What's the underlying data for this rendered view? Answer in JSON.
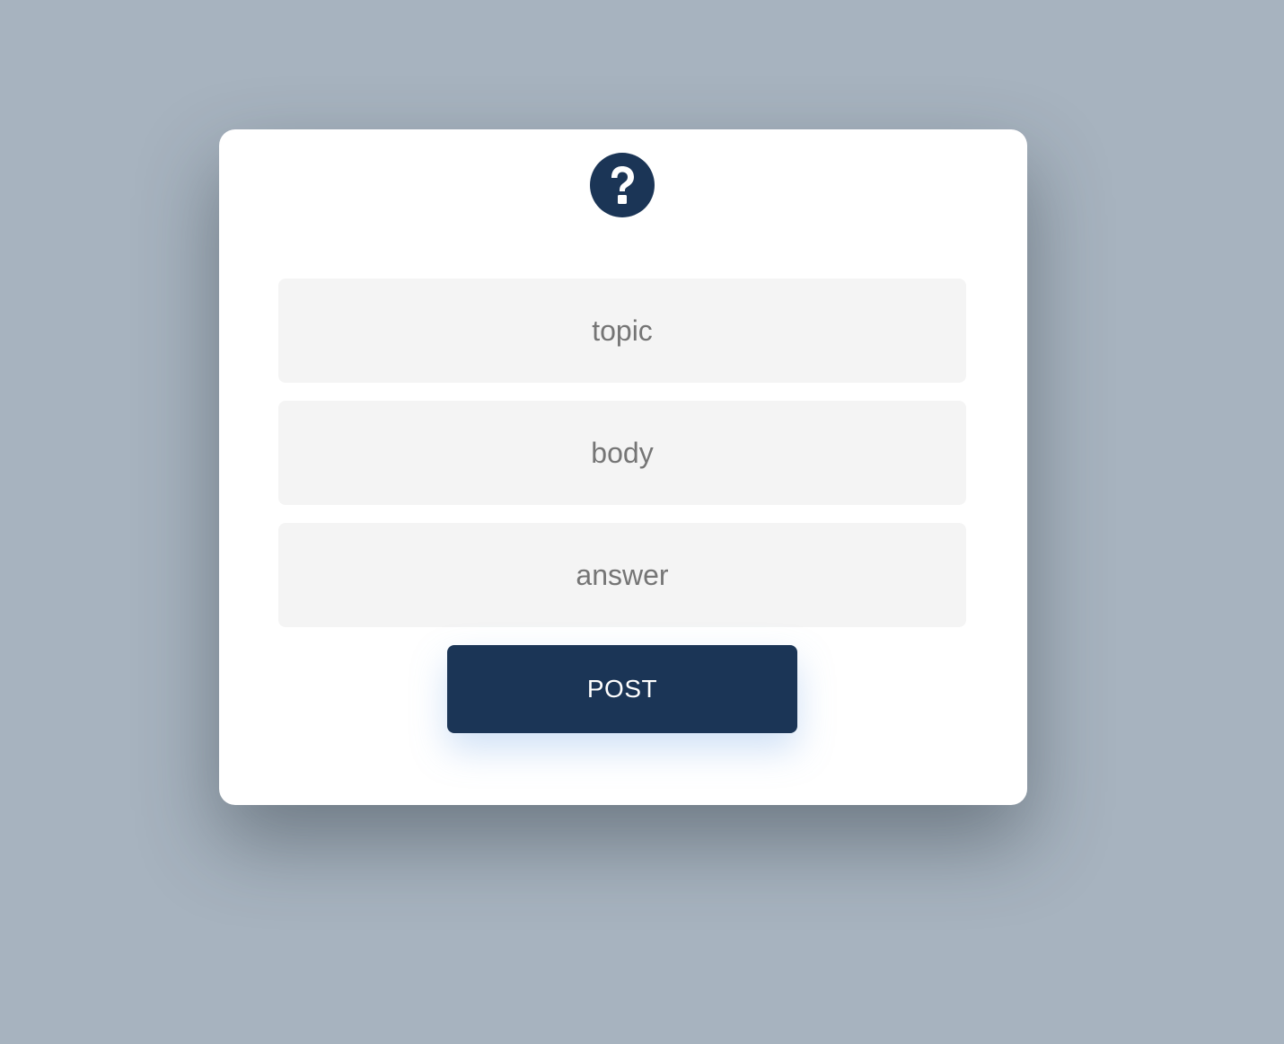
{
  "form": {
    "icon": "question-circle-icon",
    "fields": [
      {
        "placeholder": "topic",
        "value": ""
      },
      {
        "placeholder": "body",
        "value": ""
      },
      {
        "placeholder": "answer",
        "value": ""
      }
    ],
    "submit_label": "POST"
  },
  "colors": {
    "background": "#a7b3bf",
    "card": "#ffffff",
    "accent": "#1b3556",
    "field_background": "#f4f4f4",
    "placeholder_text": "#757575"
  }
}
